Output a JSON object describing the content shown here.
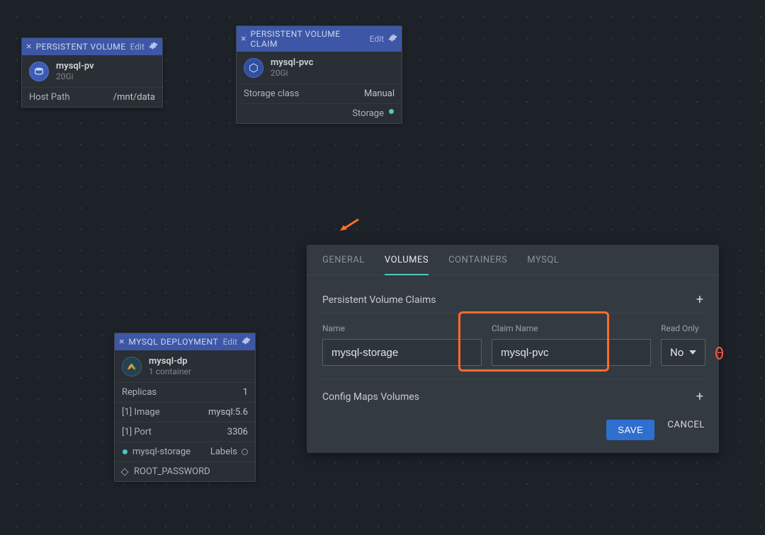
{
  "nodes": {
    "pv": {
      "type": "PERSISTENT VOLUME",
      "edit": "Edit",
      "name": "mysql-pv",
      "size": "20Gi",
      "row_key": "Host Path",
      "row_val": "/mnt/data"
    },
    "pvc": {
      "type": "PERSISTENT VOLUME CLAIM",
      "edit": "Edit",
      "name": "mysql-pvc",
      "size": "20Gi",
      "row_key": "Storage class",
      "row_val": "Manual",
      "port_label": "Storage"
    },
    "deploy": {
      "type": "MYSQL DEPLOYMENT",
      "edit": "Edit",
      "name": "mysql-dp",
      "sub": "1 container",
      "rows": [
        {
          "k": "Replicas",
          "v": "1"
        },
        {
          "k": "[1] Image",
          "v": "mysql:5.6"
        },
        {
          "k": "[1] Port",
          "v": "3306"
        }
      ],
      "port_label": "mysql-storage",
      "labels_label": "Labels",
      "env_var": "ROOT_PASSWORD"
    }
  },
  "panel": {
    "tabs": [
      "GENERAL",
      "VOLUMES",
      "CONTAINERS",
      "MYSQL"
    ],
    "active_tab": 1,
    "section_pvc": "Persistent Volume Claims",
    "labels": {
      "name": "Name",
      "claim": "Claim Name",
      "readonly": "Read Only"
    },
    "values": {
      "name": "mysql-storage",
      "claim": "mysql-pvc",
      "readonly": "No"
    },
    "section_cm": "Config Maps Volumes",
    "buttons": {
      "save": "SAVE",
      "cancel": "CANCEL"
    }
  }
}
